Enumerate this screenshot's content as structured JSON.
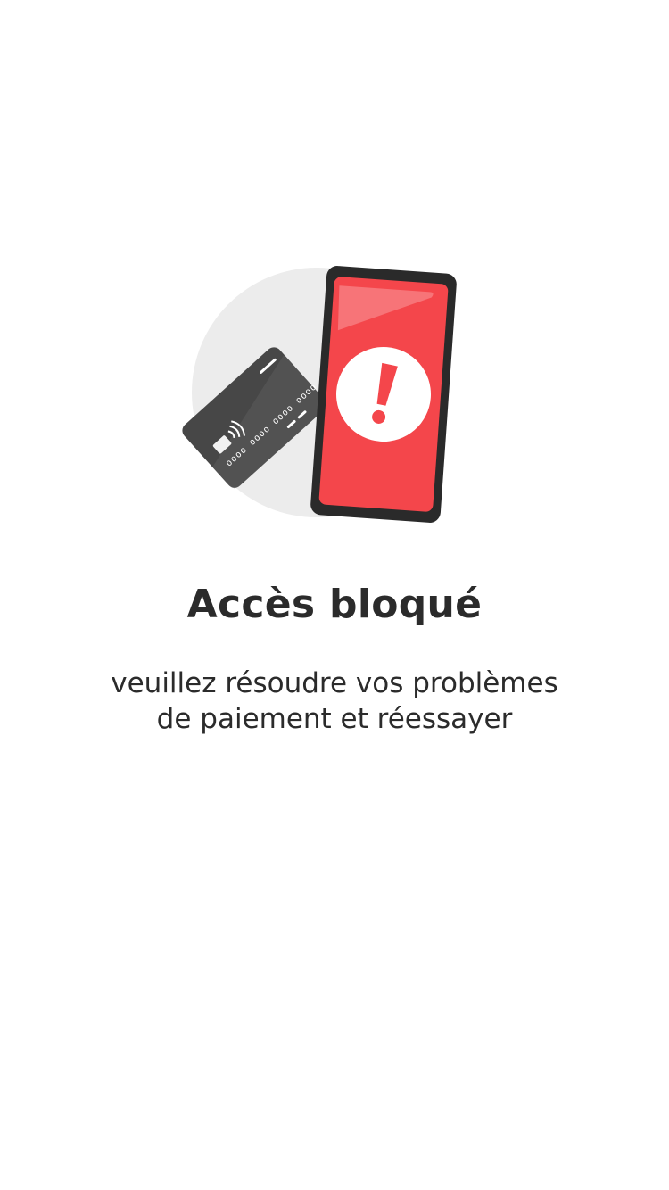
{
  "blocked_screen": {
    "illustration_icon": "card-and-phone-alert-icon",
    "title": "Accès bloqué",
    "message_line1": "veuillez résoudre vos problèmes",
    "message_line2": "de paiement et réessayer"
  },
  "colors": {
    "background": "#ffffff",
    "text": "#2b2b2b",
    "circle_bg": "#ececec",
    "phone_body": "#2a2a2a",
    "phone_screen": "#f4464b",
    "card": "#4a4a4a",
    "alert_mark": "#f4464b"
  }
}
